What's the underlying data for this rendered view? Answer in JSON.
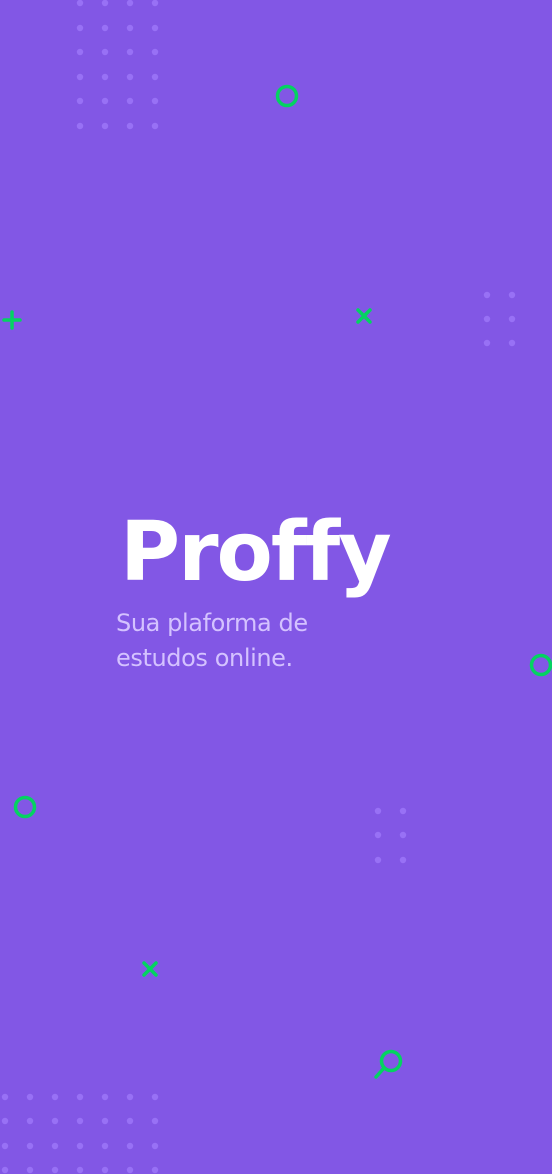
{
  "brand": {
    "logo_text": "Proffy",
    "tagline_line1": "Sua plaforma de",
    "tagline_line2": "estudos online."
  },
  "colors": {
    "background": "#8257e5",
    "logo": "#ffffff",
    "tagline": "#d4c2ff",
    "dot": "#9871f5",
    "accent": "#04d361"
  },
  "decorations": {
    "icons": [
      "ring-icon",
      "plus-icon",
      "x-icon",
      "search-icon"
    ]
  }
}
